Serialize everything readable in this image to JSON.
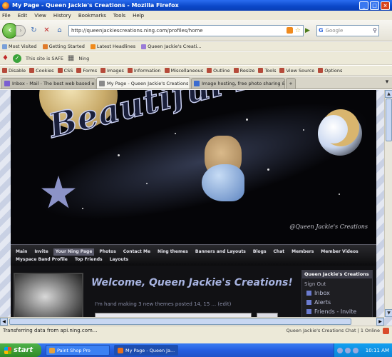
{
  "window": {
    "title": "My Page - Queen Jackie's Creations - Mozilla Firefox"
  },
  "menu": [
    "File",
    "Edit",
    "View",
    "History",
    "Bookmarks",
    "Tools",
    "Help"
  ],
  "navbar": {
    "url": "http://queenjackiescreations.ning.com/profiles/home",
    "search_engine": "G",
    "search_placeholder": "Google"
  },
  "bookmarks": [
    "Most Visited",
    "Getting Started",
    "Latest Headlines",
    "Queen Jackie's Creati..."
  ],
  "toolbar2": {
    "items": [
      "This site is SAFE",
      "Ning"
    ]
  },
  "webdev": [
    "Disable",
    "Cookies",
    "CSS",
    "Forms",
    "Images",
    "Information",
    "Miscellaneous",
    "Outline",
    "Resize",
    "Tools",
    "View Source",
    "Options"
  ],
  "tabs": [
    {
      "label": "Inbox - Mail - The best web based email",
      "active": false
    },
    {
      "label": "My Page - Queen Jackie's Creations",
      "active": true
    },
    {
      "label": "Image hosting, free photo sharing & v...",
      "active": false
    }
  ],
  "banner": {
    "title": "Beautiful Dreams",
    "copyright": "@Queen Jackie's Creations"
  },
  "site_nav": [
    "Main",
    "Invite",
    "Your Ning Page",
    "Photos",
    "Contact Me",
    "Ning themes",
    "Banners and Layouts",
    "Blogs",
    "Chat",
    "Members",
    "Member Videos",
    "Myspace Band Profile",
    "Top Friends",
    "Layouts"
  ],
  "site_nav_active": "Your Ning Page",
  "profile": {
    "welcome": "Welcome, Queen Jackie's Creations!",
    "status": "I'm hand making 3 new themes posted 14, 15 ... (edit)"
  },
  "sidebox": {
    "header": "Queen Jackie's Creations",
    "sign_out": "Sign Out",
    "items": [
      "Inbox",
      "Alerts",
      "Friends - Invite"
    ]
  },
  "statusbar": {
    "left": "Transferring data from api.ning.com...",
    "right": "Queen Jackie's Creations Chat | 1 Online"
  },
  "taskbar": {
    "start": "start",
    "tasks": [
      {
        "label": "Paint Shop Pro",
        "active": false
      },
      {
        "label": "My Page - Queen Ja...",
        "active": true
      }
    ],
    "clock": "10:11 AM"
  }
}
